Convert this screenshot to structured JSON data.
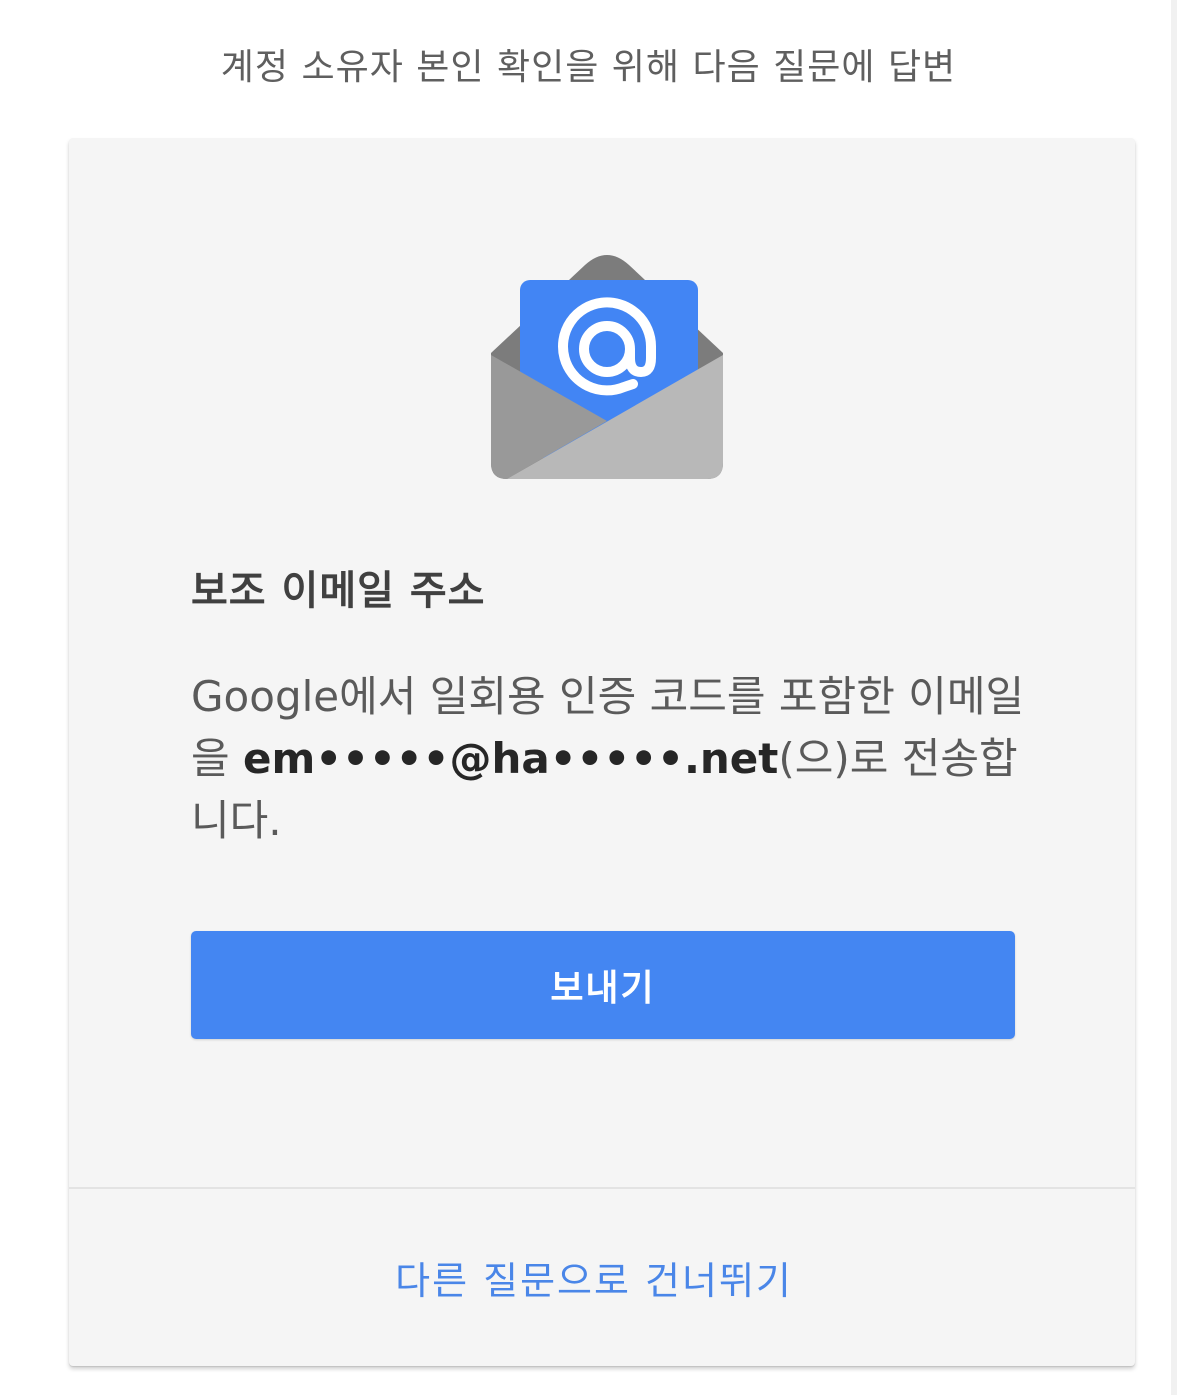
{
  "header": {
    "title": "계정 소유자 본인 확인을 위해 다음 질문에 답변"
  },
  "card": {
    "icon": "email-envelope-icon",
    "title": "보조 이메일 주소",
    "description_prefix": "Google에서 일회용 인증 코드를 포함한 이메일을 ",
    "masked_email": "em•••••@ha•••••.net",
    "description_suffix": "(으)로 전송합니다.",
    "send_button_label": "보내기",
    "skip_link_label": "다른 질문으로 건너뛰기"
  },
  "colors": {
    "accent": "#4486f2",
    "link": "#4a86e8",
    "card_bg": "#f5f5f5",
    "envelope_dark": "#7c7c7c",
    "envelope_light": "#b8b8b8"
  }
}
